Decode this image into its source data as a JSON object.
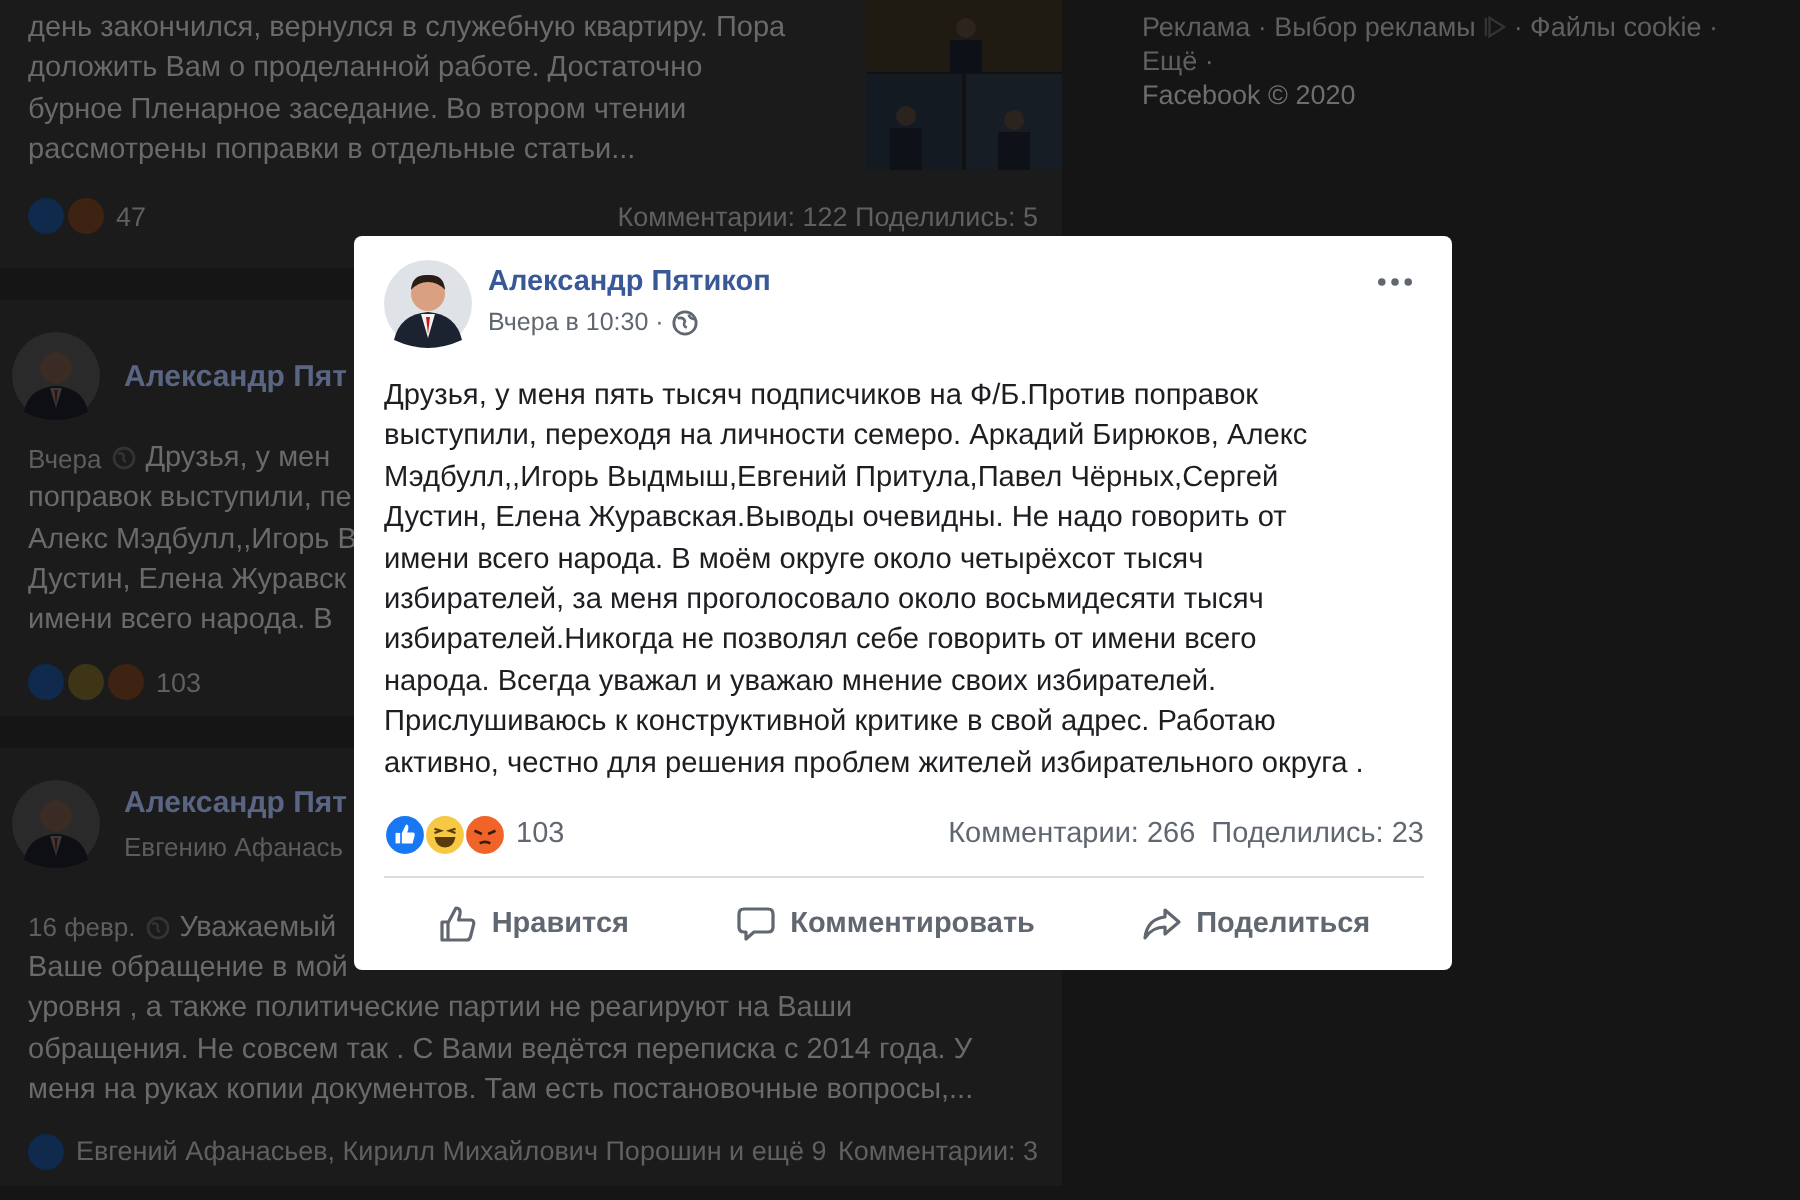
{
  "feed": [
    {
      "kind": "tail",
      "text_lines": [
        "день закончился, вернулся в служебную квартиру. Пора",
        "доложить Вам о проделанной работе. Достаточно",
        "бурное Пленарное заседание. Во втором чтении",
        "рассмотрены поправки в отдельные статьи..."
      ],
      "photo": {
        "kind": "picture"
      },
      "reactions": [
        {
          "kind": "like"
        },
        {
          "kind": "angry"
        }
      ],
      "reaction_count": "47",
      "stats": "Комментарии: 122  Поделились: 5"
    },
    {
      "kind": "post",
      "author": "Александр Пят",
      "meta": "Вчера",
      "text_lines": [
        "Друзья, у мен",
        "поправок выступили, пе",
        "Алекс Мэдбулл,,Игорь В",
        "Дустин, Елена Журавск",
        "имени всего народа. В"
      ],
      "reactions": [
        {
          "kind": "like"
        },
        {
          "kind": "haha"
        },
        {
          "kind": "angry"
        }
      ],
      "reaction_count": "103"
    },
    {
      "kind": "post",
      "author": "Александр Пят",
      "subtitle": "Евгению Афанась",
      "meta": "16 февр.",
      "text_lines": [
        "Уважаемый",
        "Ваше обращение в мой",
        "уровня , а также политические партии не реагируют на Ваши",
        "обращения. Не совсем так . С Вами ведётся переписка с 2014 года. У",
        "меня на руках копии документов. Там есть постановочные вопросы,..."
      ],
      "reactions": [
        {
          "kind": "like"
        }
      ],
      "likers": "Евгений Афанасьев, Кирилл Михайлович Порошин и ещё 9",
      "stats": "Комментарии: 3"
    }
  ],
  "sidebar_footer": {
    "line_1_start": "Реклама · Выбор рекламы",
    "line_1_end": "· Файлы cookie ·",
    "line_2": "Ещё ·",
    "copyright": "Facebook © 2020"
  },
  "modal": {
    "author": "Александр Пятикоп",
    "time": "Вчера в 10:30 ·",
    "text": "Друзья, у меня пять тысяч подписчиков на Ф/Б.Против поправок выступили, переходя на личности семеро. Аркадий Бирюков, Алекс Мэдбулл,,Игорь Выдмыш,Евгений Притула,Павел Чёрных,Сергей Дустин, Елена Журавская.Выводы очевидны. Не надо говорить от имени всего народа. В моём округе около четырёхсот тысяч избирателей, за меня проголосовало около восьмидесяти тысяч избирателей.Никогда не позволял себе говорить от имени всего народа. Всегда уважал и уважаю мнение своих избирателей. Прислушиваюсь к конструктивной критике в свой адрес. Работаю активно, честно для решения проблем жителей избирательного округа .",
    "reactions": [
      {
        "kind": "like"
      },
      {
        "kind": "haha"
      },
      {
        "kind": "angry"
      }
    ],
    "reaction_count": "103",
    "comments": "Комментарии: 266",
    "shares": "Поделились: 23",
    "actions": [
      {
        "kind": "like",
        "label": "Нравится"
      },
      {
        "kind": "comment",
        "label": "Комментировать"
      },
      {
        "kind": "share",
        "label": "Поделиться"
      }
    ]
  }
}
